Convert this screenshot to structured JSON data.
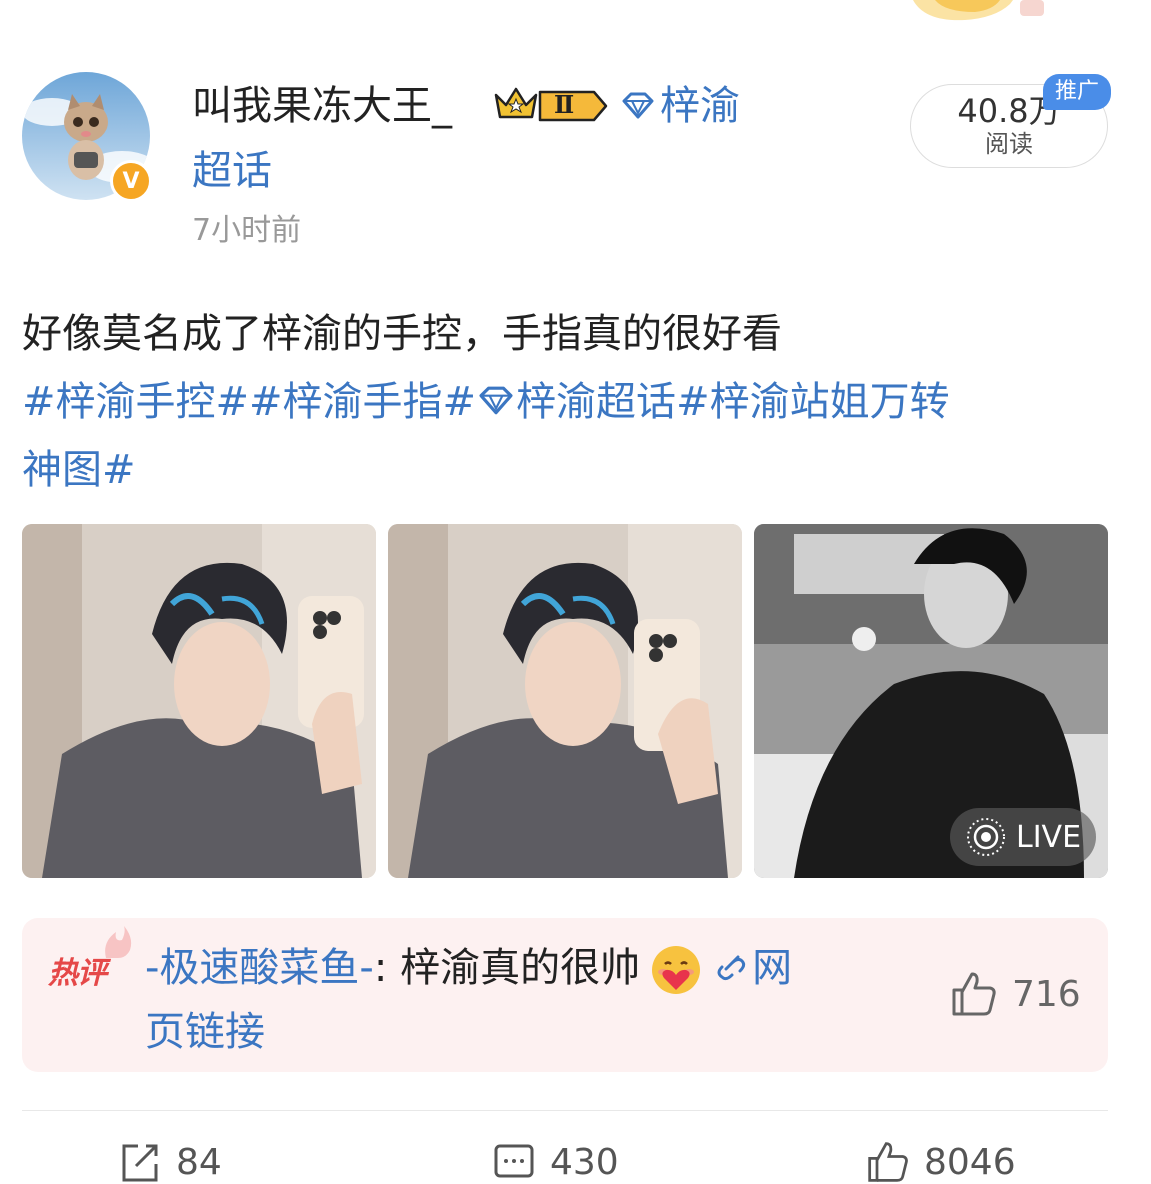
{
  "author": {
    "name": "叫我果冻大王_",
    "level": "Ⅱ",
    "supertopic": "梓渝",
    "supertopic_cont": "超话",
    "verified_mark": "V",
    "time": "7小时前"
  },
  "stats": {
    "read_count": "40.8万",
    "read_label": "阅读",
    "promo_badge": "推广"
  },
  "post": {
    "text": "好像莫名成了梓渝的手控，手指真的很好看",
    "tag1": "#梓渝手控#",
    "tag2": "#梓渝手指#",
    "tag3": "梓渝超话",
    "tag4": "#梓渝站姐万转",
    "tag4_cont": "神图#"
  },
  "images": {
    "live_label": "LIVE"
  },
  "hot_comment": {
    "label": "热评",
    "user": "-极速酸菜鱼-",
    "separator": ": ",
    "text": "梓渝真的很帅",
    "link_part1": "网",
    "link_part2": "页链接",
    "likes": "716"
  },
  "actions": {
    "repost_count": "84",
    "comment_count": "430",
    "like_count": "8046"
  },
  "colors": {
    "link_blue": "#3b76c2",
    "hot_red": "#e54848",
    "badge_orange": "#f6a623",
    "promo_blue": "#4a8de8"
  }
}
